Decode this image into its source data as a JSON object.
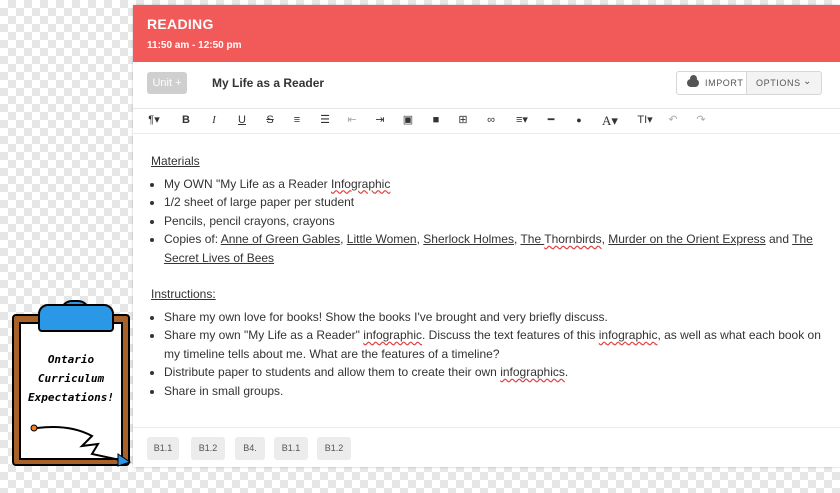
{
  "header": {
    "title": "READING",
    "time": "11:50 am - 12:50 pm"
  },
  "unit_row": {
    "unit_button": "Unit +",
    "lesson_title": "My Life as a Reader",
    "import_label": "IMPORT",
    "options_label": "OPTIONS"
  },
  "toolbar": {
    "items": [
      {
        "name": "paragraph-format-dropdown",
        "glyph": "¶▾"
      },
      {
        "name": "bold-button",
        "glyph": "B"
      },
      {
        "name": "italic-button",
        "glyph": "I"
      },
      {
        "name": "underline-button",
        "glyph": "U"
      },
      {
        "name": "strikethrough-button",
        "glyph": "S"
      },
      {
        "name": "ordered-list-button",
        "glyph": "≡"
      },
      {
        "name": "unordered-list-button",
        "glyph": "☰"
      },
      {
        "name": "outdent-button",
        "glyph": "⇤"
      },
      {
        "name": "indent-button",
        "glyph": "⇥"
      },
      {
        "name": "insert-image-button",
        "glyph": "▣"
      },
      {
        "name": "insert-video-button",
        "glyph": "■"
      },
      {
        "name": "insert-table-button",
        "glyph": "⊞"
      },
      {
        "name": "insert-link-button",
        "glyph": "∞"
      },
      {
        "name": "align-dropdown",
        "glyph": "≡▾"
      },
      {
        "name": "horizontal-rule-button",
        "glyph": "━"
      },
      {
        "name": "text-color-button",
        "glyph": "●"
      },
      {
        "name": "font-family-dropdown",
        "glyph": "A▾"
      },
      {
        "name": "font-size-dropdown",
        "glyph": "TI▾"
      },
      {
        "name": "undo-button",
        "glyph": "↶"
      },
      {
        "name": "redo-button",
        "glyph": "↷"
      }
    ]
  },
  "content": {
    "materials_heading": "Materials",
    "materials": {
      "m1_a": "My OWN \"My Life as a Reader ",
      "m1_b": "Infographic",
      "m2": "1/2 sheet of large paper per student",
      "m3": "Pencils, pencil crayons, crayons",
      "m4_intro": "Copies of:  ",
      "book1": "Anne of Green Gables",
      "book2": "Little Women",
      "book3": "Sherlock Holmes",
      "book4_a": "The ",
      "book4_b": "Thornbirds",
      "book5": "Murder on the Orient Express",
      "and": " and ",
      "book6": "The Secret Lives of Bees",
      "comma": ", "
    },
    "instructions_heading": "Instructions:",
    "instructions": {
      "i1": "Share my own love for books!  Show the books I've brought and very briefly discuss.",
      "i2_a": "Share my own \"My Life as a Reader\" ",
      "i2_b": "infographic",
      "i2_c": ".  Discuss the text features of this ",
      "i2_d": "infographic",
      "i2_e": ", as well as what each book on my timeline tells about me.  What are the features of a timeline?",
      "i3_a": "Distribute paper to students and allow them to create their own ",
      "i3_b": "infographics",
      "i3_c": ".",
      "i4": "Share in small groups."
    }
  },
  "footer": {
    "tags": [
      "B1.1",
      "B1.2",
      "B4.",
      "B1.1",
      "B1.2"
    ]
  },
  "clipboard": {
    "lines": [
      "Ontario",
      "Curriculum",
      "Expectations!"
    ]
  },
  "colors": {
    "header": "#f25a5a",
    "clip": "#2a98e6",
    "board": "#a9612a"
  }
}
